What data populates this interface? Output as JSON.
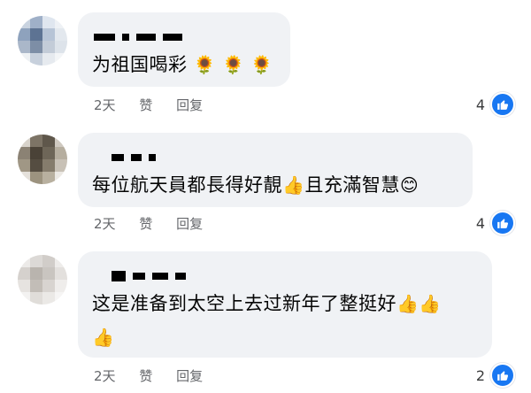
{
  "comments": [
    {
      "text": "为祖国喝彩",
      "emojis": "🌻 🌻 🌻",
      "time": "2天",
      "like_label": "赞",
      "reply_label": "回复",
      "reaction_count": "4"
    },
    {
      "text": "每位航天員都長得好靚",
      "emoji_mid": "👍",
      "text2": "且充滿智慧",
      "emoji_end": "😊",
      "time": "2天",
      "like_label": "赞",
      "reply_label": "回复",
      "reaction_count": "4"
    },
    {
      "text": "这是准备到太空上去过新年了整挺好",
      "emojis_end": "👍👍",
      "emoji_line2": "👍",
      "time": "2天",
      "like_label": "赞",
      "reply_label": "回复",
      "reaction_count": "2"
    }
  ],
  "colors": {
    "bubble": "#f0f2f5",
    "meta_text": "#65676b",
    "reaction_blue": "#1877f2"
  },
  "icons": {
    "reaction": "thumbs-up-icon"
  }
}
